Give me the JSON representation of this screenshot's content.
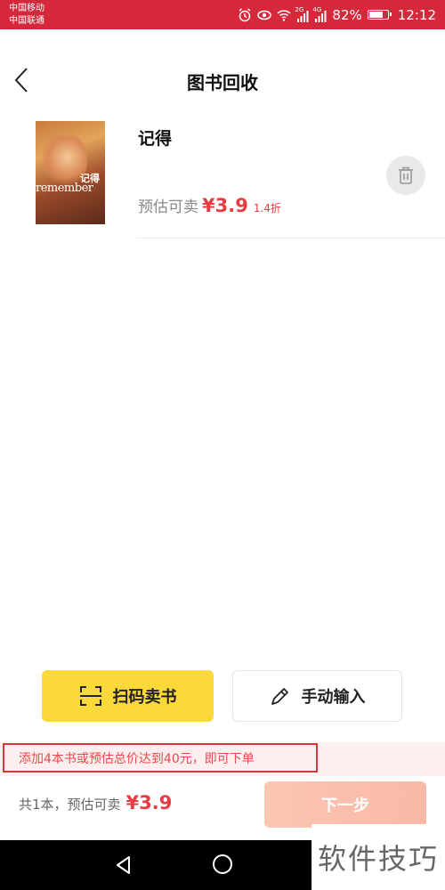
{
  "status_bar": {
    "carrier1": "中国移动",
    "carrier2": "中国联通",
    "net1": "2G",
    "net2": "4G",
    "battery": "82%",
    "battery_level": 0.82,
    "time": "12:12",
    "color": "#d5283b"
  },
  "header": {
    "title": "图书回收",
    "back_icon": "chevron-left-icon"
  },
  "book": {
    "title": "记得",
    "cover_text": "remember",
    "cover_title": "记得",
    "price_label": "预估可卖",
    "price": "¥3.9",
    "discount": "1.4折",
    "delete_icon": "trash-icon"
  },
  "actions": {
    "scan_label": "扫码卖书",
    "manual_label": "手动输入",
    "scan_color": "#fbd93a"
  },
  "notice": "添加4本书或预估总价达到40元，即可下单",
  "bottom": {
    "summary_label": "共1本，预估可卖",
    "summary_price": "¥3.9",
    "next_label": "下一步"
  },
  "watermark": "软件技巧",
  "accent_color": "#e83b42"
}
